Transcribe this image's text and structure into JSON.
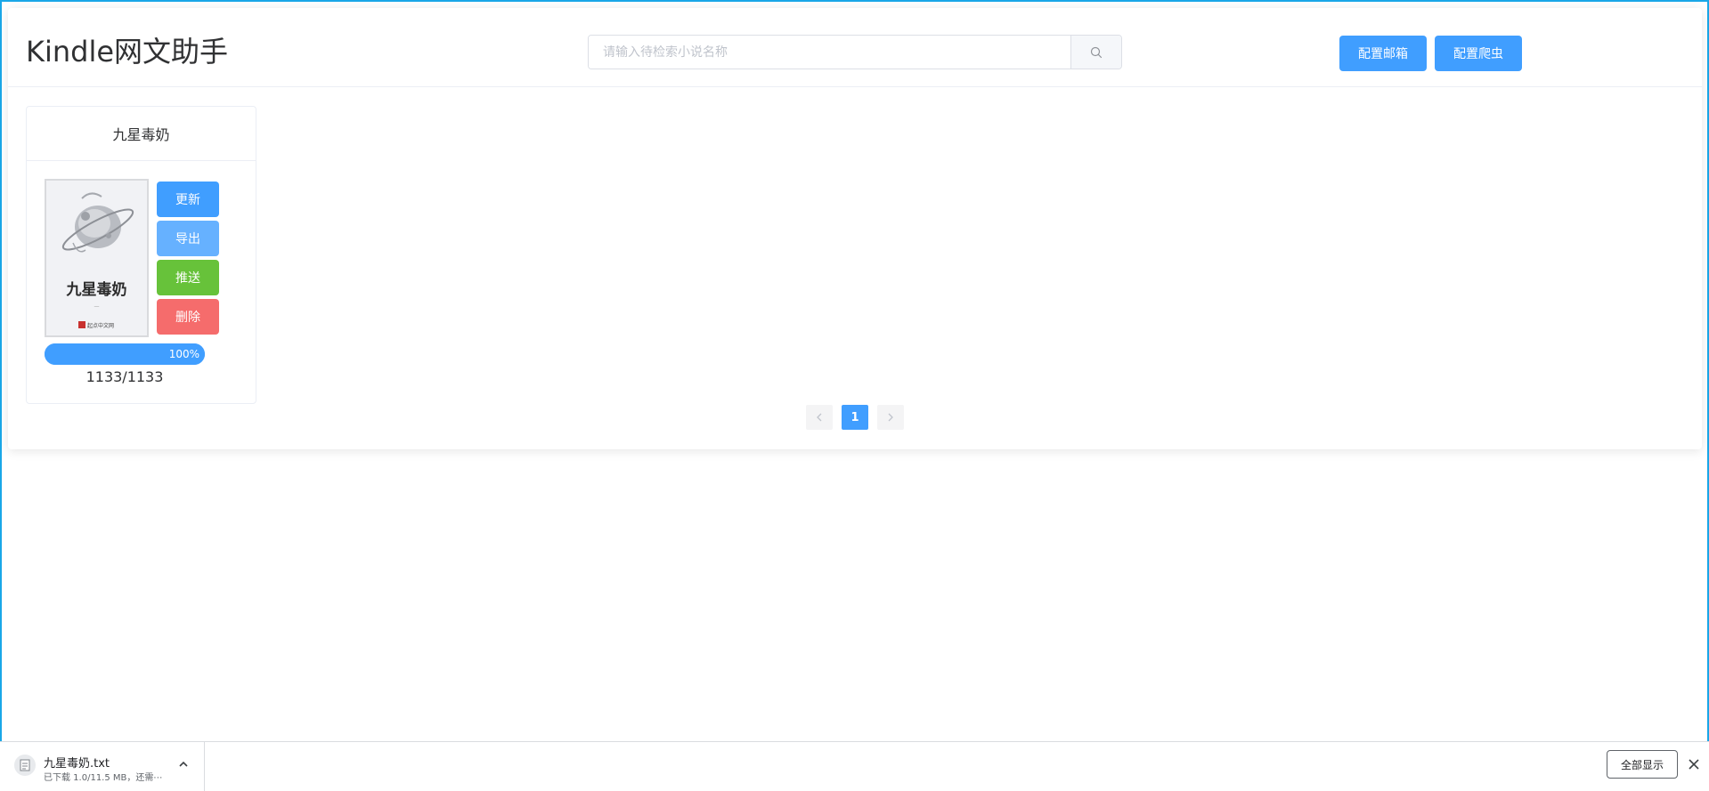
{
  "app": {
    "title": "Kindle网文助手"
  },
  "search": {
    "placeholder": "请输入待检索小说名称",
    "value": ""
  },
  "header": {
    "config_mail_label": "配置邮箱",
    "config_crawler_label": "配置爬虫"
  },
  "books": [
    {
      "title": "九星毒奶",
      "cover_title": "九星毒奶",
      "cover_publisher": "起点中文网",
      "actions": {
        "update": "更新",
        "export": "导出",
        "push": "推送",
        "delete": "删除"
      },
      "progress_percent": 100,
      "progress_label": "100%",
      "count_label": "1133/1133"
    }
  ],
  "pagination": {
    "current_page": "1",
    "prev_icon": "chevron-left-icon",
    "next_icon": "chevron-right-icon"
  },
  "download_bar": {
    "file_name": "九星毒奶.txt",
    "status": "已下载 1.0/11.5 MB，还需⋯",
    "show_all_label": "全部显示"
  },
  "colors": {
    "primary": "#409eff",
    "primary_light": "#66b1ff",
    "success": "#67c23a",
    "danger": "#f56c6c",
    "frame": "#1aa7e8"
  }
}
